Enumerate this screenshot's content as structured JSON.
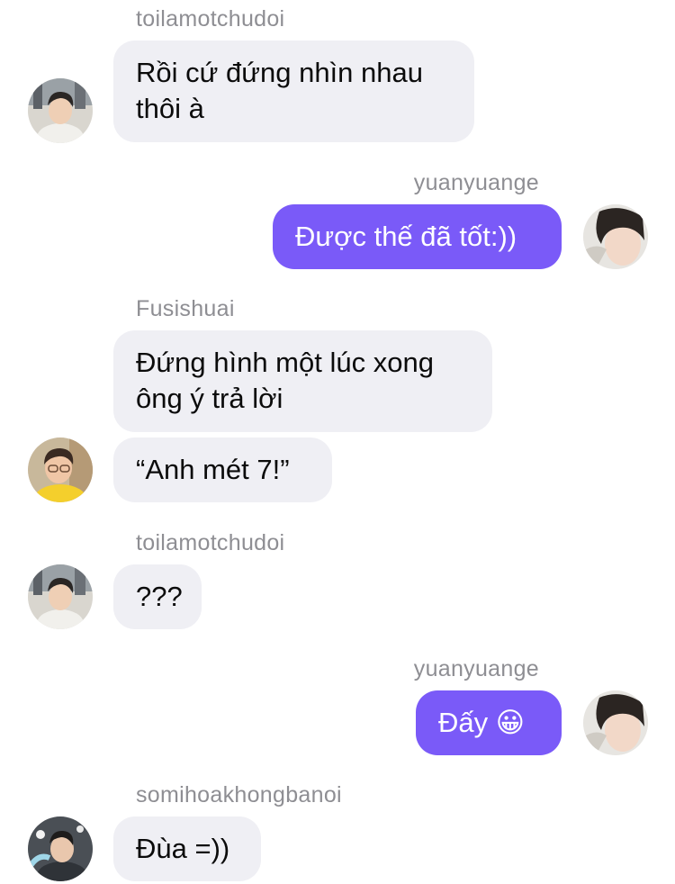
{
  "conversation": {
    "messages": [
      {
        "sender": "toilamotchudoi",
        "direction": "incoming",
        "lines": [
          "Rồi cứ đứng nhìn nhau",
          "thôi à"
        ]
      },
      {
        "sender": "yuanyuange",
        "direction": "outgoing",
        "lines": [
          "Được thế đã tốt:))"
        ]
      },
      {
        "sender": "Fusishuai",
        "direction": "incoming",
        "lines": [
          "Đứng hình một lúc xong",
          "ông ý trả lời"
        ]
      },
      {
        "sender": "Fusishuai",
        "direction": "incoming",
        "lines": [
          "“Anh mét 7!”"
        ]
      },
      {
        "sender": "toilamotchudoi",
        "direction": "incoming",
        "lines": [
          "???"
        ]
      },
      {
        "sender": "yuanyuange",
        "direction": "outgoing",
        "lines": [
          "Đấy 😀"
        ]
      },
      {
        "sender": "somihoakhongbanoi",
        "direction": "incoming",
        "lines": [
          "Đùa =))"
        ]
      }
    ]
  },
  "colors": {
    "incoming_bubble": "#efeff4",
    "outgoing_bubble": "#7a5af8",
    "sender_name": "#8e8e93"
  },
  "icons": [
    "avatar-photo"
  ]
}
